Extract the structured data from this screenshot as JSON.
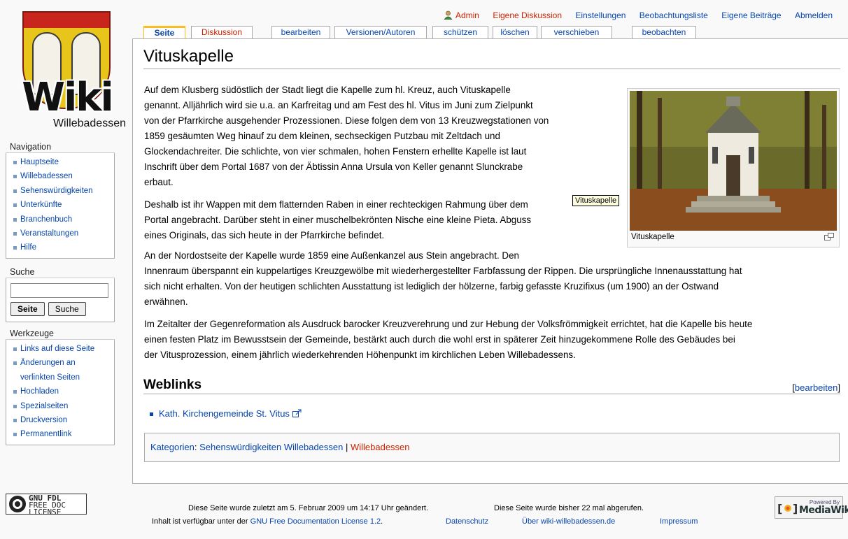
{
  "logo": {
    "wordmark": "Wiki",
    "subtitle": "Willebadessen"
  },
  "personal": {
    "user": "Admin",
    "talk": "Eigene Diskussion",
    "prefs": "Einstellungen",
    "watchlist": "Beobachtungsliste",
    "contribs": "Eigene Beiträge",
    "logout": "Abmelden"
  },
  "tabs": {
    "page": "Seite",
    "discussion": "Diskussion",
    "edit": "bearbeiten",
    "history": "Versionen/Autoren",
    "protect": "schützen",
    "delete": "löschen",
    "move": "verschieben",
    "watch": "beobachten"
  },
  "article": {
    "title": "Vituskapelle",
    "p1": [
      "Auf dem Klusberg südöstlich der Stadt liegt die Kapelle zum hl. Kreuz, auch Vituskapelle",
      "genannt. Alljährlich wird sie u.a. an Karfreitag und am Fest des hl. Vitus im Juni zum Zielpunkt",
      "von der Pfarrkirche ausgehender Prozessionen. Diese folgen dem von 13 Kreuzwegstationen von",
      "1859 gesäumten Weg hinauf zu dem kleinen, sechseckigen Putzbau mit Zeltdach und",
      "Glockendachreiter. Die schlichte, von vier schmalen, hohen Fenstern erhellte Kapelle ist laut",
      "Inschrift über dem Portal 1687 von der Äbtissin Anna Ursula von Keller genannt Slunckrabe",
      "erbaut."
    ],
    "p2": [
      "Deshalb ist ihr Wappen mit dem flatternden Raben in einer rechteckigen Rahmung über dem",
      "Portal angebracht. Darüber steht in einer muschelbekrönten Nische eine kleine Pieta. Abguss",
      "eines Originals, das sich heute in der Pfarrkirche befindet."
    ],
    "p3": [
      "An der Nordostseite der Kapelle wurde 1859 eine Außenkanzel aus Stein angebracht. Den",
      "Innenraum überspannt ein kuppelartiges Kreuzgewölbe mit wiederhergestellter Farbfassung der Rippen. Die ursprüngliche Innenausstattung hat",
      "sich nicht erhalten. Von der heutigen schlichten Ausstattung ist lediglich der hölzerne, farbig gefasste Kruzifixus (um 1900) an der Ostwand",
      "erwähnen."
    ],
    "p4": [
      "Im Zeitalter der Gegenreformation als Ausdruck barocker Kreuzverehrung und zur Hebung der Volksfrömmigkeit errichtet, hat die Kapelle bis heute",
      "einen festen Platz im Bewusstsein der Gemeinde, bestärkt auch durch die wohl erst in späterer Zeit hinzugekommene Rolle des Gebäudes bei",
      "der Vitusprozession, einem jährlich wiederkehrenden Höhenpunkt im kirchlichen Leben Willebadessens."
    ],
    "thumb_caption": "Vituskapelle",
    "tooltip": "Vituskapelle",
    "weblinks_heading": "Weblinks",
    "edit_open": "[",
    "edit_label": "bearbeiten",
    "edit_close": "]",
    "external_link": "Kath. Kirchengemeinde St. Vitus",
    "categories_label": "Kategorien",
    "categories_colon": ": ",
    "category_1": "Sehenswürdigkeiten Willebadessen",
    "category_sep": " | ",
    "category_2": "Willebadessen"
  },
  "sidebar": {
    "nav_title": "Navigation",
    "nav": [
      "Hauptseite",
      "Willebadessen",
      "Sehenswürdigkeiten",
      "Unterkünfte",
      "Branchenbuch",
      "Veranstaltungen",
      "Hilfe"
    ],
    "search_title": "Suche",
    "search_go": "Seite",
    "search_full": "Suche",
    "tools_title": "Werkzeuge",
    "tools": [
      "Links auf diese Seite",
      "Änderungen an verlinkten Seiten",
      "Hochladen",
      "Spezialseiten",
      "Druckversion",
      "Permanentlink"
    ]
  },
  "footer": {
    "lastmod": "Diese Seite wurde zuletzt am 5. Februar 2009 um 14:17 Uhr geändert.",
    "views": "Diese Seite wurde bisher 22 mal abgerufen.",
    "license_prefix": "Inhalt ist verfügbar unter der ",
    "license_link": "GNU Free Documentation License 1.2",
    "license_suffix": ".",
    "privacy": "Datenschutz",
    "about": "Über wiki-willebadessen.de",
    "imprint": "Impressum",
    "gnu_badge_l1": "GNU FDL",
    "gnu_badge_l2": "FREE DOC",
    "gnu_badge_l3": "LICENSE",
    "mw_badge_small": "Powered By",
    "mw_badge_big": "MediaWiki"
  },
  "colors": {
    "link": "#0645ad",
    "new_link": "#cc2200",
    "tab_selected": "#fabd23"
  }
}
